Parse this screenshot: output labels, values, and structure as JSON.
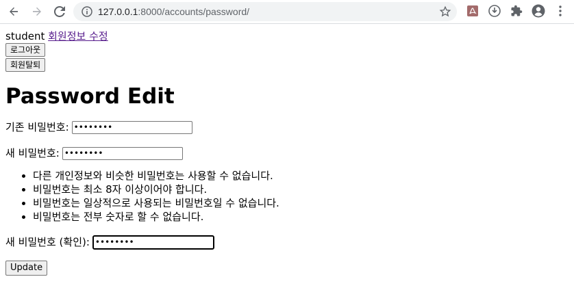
{
  "browser": {
    "url_host": "127.0.0.1",
    "url_path": ":8000/accounts/password/"
  },
  "header": {
    "username": "student",
    "edit_profile_link": "회원정보 수정",
    "logout_button": "로그아웃",
    "withdraw_button": "회원탈퇴"
  },
  "main": {
    "title": "Password Edit",
    "old_password_label": "기존 비밀번호:",
    "old_password_value": "••••••••",
    "new_password_label": "새 비밀번호:",
    "new_password_value": "••••••••",
    "help_items": [
      "다른 개인정보와 비슷한 비밀번호는 사용할 수 없습니다.",
      "비밀번호는 최소 8자 이상이어야 합니다.",
      "비밀번호는 일상적으로 사용되는 비밀번호일 수 없습니다.",
      "비밀번호는 전부 숫자로 할 수 없습니다."
    ],
    "confirm_password_label": "새 비밀번호 (확인):",
    "confirm_password_value": "••••••••",
    "submit_button": "Update"
  },
  "icons": {
    "back": "back-arrow-icon",
    "forward": "forward-arrow-icon",
    "reload": "reload-icon",
    "site_info": "info-icon",
    "bookmark": "star-icon",
    "pdf_extension": "pdf-icon",
    "download_extension": "download-icon",
    "extensions": "puzzle-icon",
    "profile": "account-icon",
    "menu": "kebab-menu-icon"
  }
}
